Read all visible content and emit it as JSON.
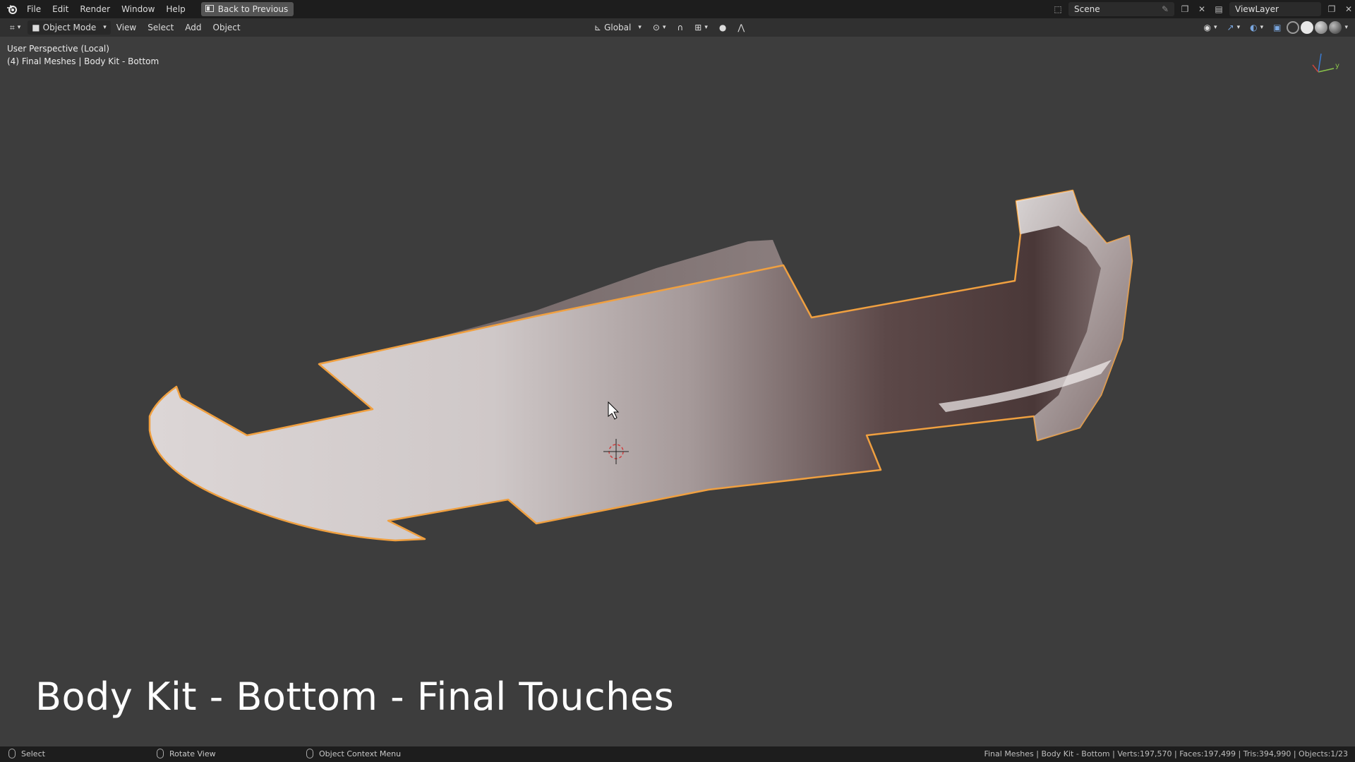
{
  "menu": {
    "items": [
      "File",
      "Edit",
      "Render",
      "Window",
      "Help"
    ],
    "back_button": "Back to Previous"
  },
  "top_right": {
    "scene_label": "Scene",
    "viewlayer_label": "ViewLayer"
  },
  "viewport_header": {
    "mode": "Object Mode",
    "menus": [
      "View",
      "Select",
      "Add",
      "Object"
    ],
    "transform_orientation": "Global"
  },
  "viewport": {
    "perspective": "User Perspective (Local)",
    "object_info": "(4) Final Meshes | Body Kit - Bottom",
    "caption": "Body Kit - Bottom - Final Touches",
    "axis_y": "y"
  },
  "statusbar": {
    "select": "Select",
    "rotate": "Rotate View",
    "context_menu": "Object Context Menu",
    "stats": "Final Meshes | Body Kit - Bottom | Verts:197,570 | Faces:197,499 | Tris:394,990 | Objects:1/23"
  },
  "colors": {
    "selection_outline": "#f0a040",
    "viewport_bg": "#3d3d3d",
    "topbar_bg": "#1d1d1d"
  }
}
